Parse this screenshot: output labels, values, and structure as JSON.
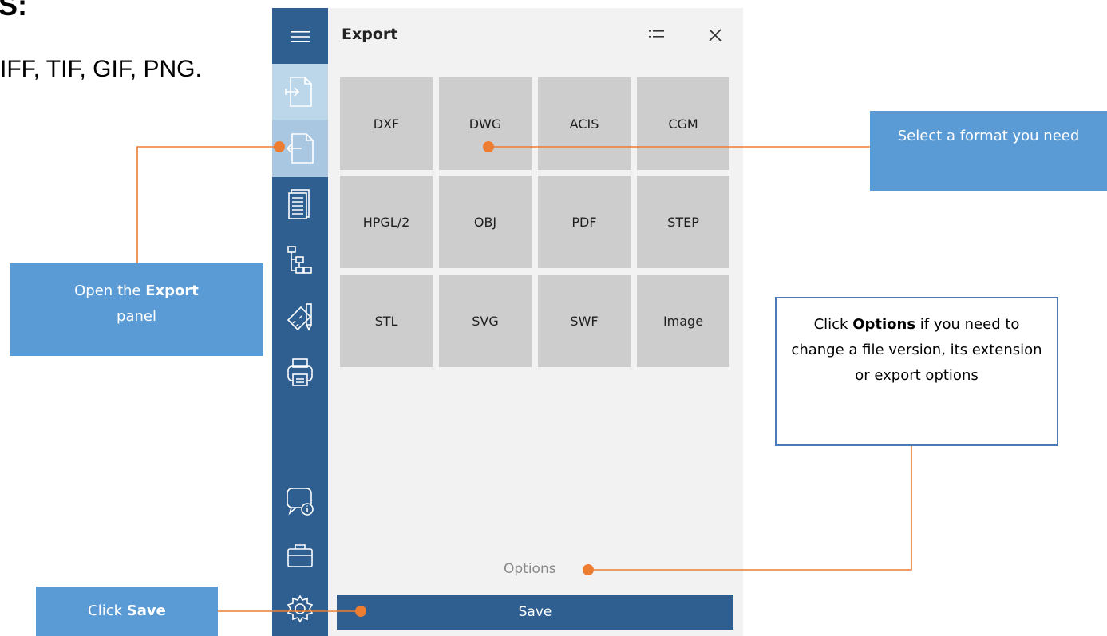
{
  "background": {
    "heading": "S:",
    "line": "IFF, TIF, GIF, PNG."
  },
  "panel": {
    "title": "Export",
    "formats": [
      "DXF",
      "DWG",
      "ACIS",
      "CGM",
      "HPGL/2",
      "OBJ",
      "PDF",
      "STEP",
      "STL",
      "SVG",
      "SWF",
      "Image"
    ],
    "options_label": "Options",
    "save_label": "Save"
  },
  "callouts": {
    "select_format": "Select a format you need",
    "open_export_prefix": "Open the ",
    "open_export_bold": "Export",
    "open_export_suffix": " panel",
    "options_prefix": "Click ",
    "options_bold": "Options",
    "options_suffix": " if you need to change a file version, its extension or export options",
    "save_prefix": "Click ",
    "save_bold": "Save"
  },
  "colors": {
    "sidebar": "#2f5f91",
    "callout_fill": "#5b9bd5",
    "connector": "#ed7d31",
    "tile": "#cdcdcd"
  }
}
